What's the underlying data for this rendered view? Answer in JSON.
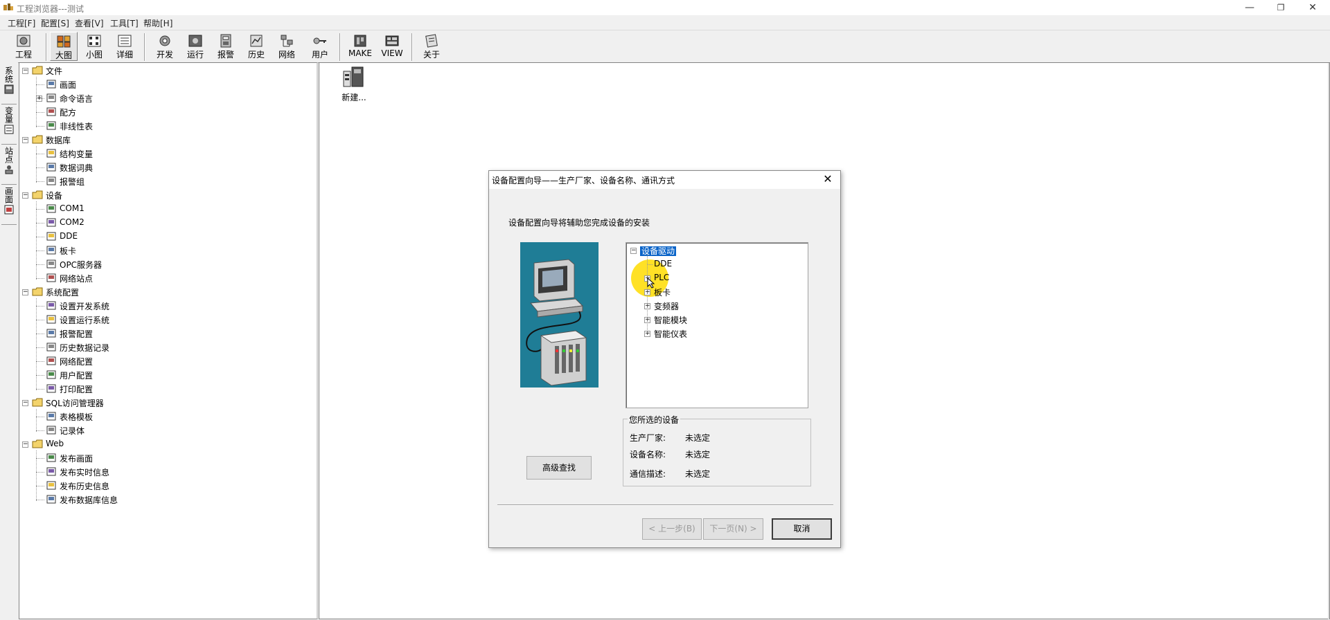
{
  "window": {
    "title": "工程浏览器---测试",
    "minimize": "—",
    "maximize": "❐",
    "close": "✕"
  },
  "menu": [
    "工程[F]",
    "配置[S]",
    "查看[V]",
    "工具[T]",
    "帮助[H]"
  ],
  "toolbar": [
    {
      "label": "工程",
      "icon": "project-icon"
    },
    {
      "label": "大图",
      "icon": "large-icons-icon",
      "pressed": true
    },
    {
      "label": "小图",
      "icon": "small-icons-icon"
    },
    {
      "label": "详细",
      "icon": "detail-icon"
    },
    {
      "label": "开发",
      "icon": "develop-icon"
    },
    {
      "label": "运行",
      "icon": "run-icon"
    },
    {
      "label": "报警",
      "icon": "alarm-icon"
    },
    {
      "label": "历史",
      "icon": "history-icon"
    },
    {
      "label": "网络",
      "icon": "network-icon"
    },
    {
      "label": "用户",
      "icon": "user-icon"
    },
    {
      "label": "MAKE",
      "icon": "make-icon"
    },
    {
      "label": "VIEW",
      "icon": "view-icon"
    },
    {
      "label": "关于",
      "icon": "about-icon"
    }
  ],
  "vtabs": [
    "系统",
    "变量",
    "站点",
    "画面"
  ],
  "tree": [
    {
      "label": "文件",
      "level": 0,
      "expander": "minus"
    },
    {
      "label": "画面",
      "level": 1
    },
    {
      "label": "命令语言",
      "level": 1,
      "expander": "plus"
    },
    {
      "label": "配方",
      "level": 1
    },
    {
      "label": "非线性表",
      "level": 1
    },
    {
      "label": "数据库",
      "level": 0,
      "expander": "minus"
    },
    {
      "label": "结构变量",
      "level": 1
    },
    {
      "label": "数据词典",
      "level": 1
    },
    {
      "label": "报警组",
      "level": 1
    },
    {
      "label": "设备",
      "level": 0,
      "expander": "minus"
    },
    {
      "label": "COM1",
      "level": 1
    },
    {
      "label": "COM2",
      "level": 1
    },
    {
      "label": "DDE",
      "level": 1
    },
    {
      "label": "板卡",
      "level": 1
    },
    {
      "label": "OPC服务器",
      "level": 1
    },
    {
      "label": "网络站点",
      "level": 1
    },
    {
      "label": "系统配置",
      "level": 0,
      "expander": "minus"
    },
    {
      "label": "设置开发系统",
      "level": 1
    },
    {
      "label": "设置运行系统",
      "level": 1
    },
    {
      "label": "报警配置",
      "level": 1
    },
    {
      "label": "历史数据记录",
      "level": 1
    },
    {
      "label": "网络配置",
      "level": 1
    },
    {
      "label": "用户配置",
      "level": 1
    },
    {
      "label": "打印配置",
      "level": 1
    },
    {
      "label": "SQL访问管理器",
      "level": 0,
      "expander": "minus"
    },
    {
      "label": "表格模板",
      "level": 1
    },
    {
      "label": "记录体",
      "level": 1
    },
    {
      "label": "Web",
      "level": 0,
      "expander": "minus"
    },
    {
      "label": "发布画面",
      "level": 1
    },
    {
      "label": "发布实时信息",
      "level": 1
    },
    {
      "label": "发布历史信息",
      "level": 1
    },
    {
      "label": "发布数据库信息",
      "level": 1
    }
  ],
  "content": {
    "new_item_label": "新建..."
  },
  "dialog": {
    "title": "设备配置向导——生产厂家、设备名称、通讯方式",
    "close": "✕",
    "intro": "设备配置向导将辅助您完成设备的安装",
    "device_tree": [
      {
        "label": "设备驱动",
        "level": 0,
        "expander": "minus",
        "selected": true
      },
      {
        "label": "DDE",
        "level": 1
      },
      {
        "label": "PLC",
        "level": 1,
        "expander": "plus"
      },
      {
        "label": "板卡",
        "level": 1,
        "expander": "plus"
      },
      {
        "label": "变频器",
        "level": 1,
        "expander": "plus"
      },
      {
        "label": "智能模块",
        "level": 1,
        "expander": "plus"
      },
      {
        "label": "智能仪表",
        "level": 1,
        "expander": "plus"
      }
    ],
    "selected_group": {
      "legend": "您所选的设备",
      "manufacturer_label": "生产厂家:",
      "manufacturer_value": "未选定",
      "device_name_label": "设备名称:",
      "device_name_value": "未选定",
      "comm_label": "通信描述:",
      "comm_value": "未选定"
    },
    "advanced_search": "高级查找",
    "prev": "< 上一步(B)",
    "next": "下一页(N) >",
    "cancel": "取消"
  },
  "colors": {
    "selection": "#0a64c8",
    "illustration_bg": "#1f7d96",
    "highlight": "#ffdc00"
  }
}
